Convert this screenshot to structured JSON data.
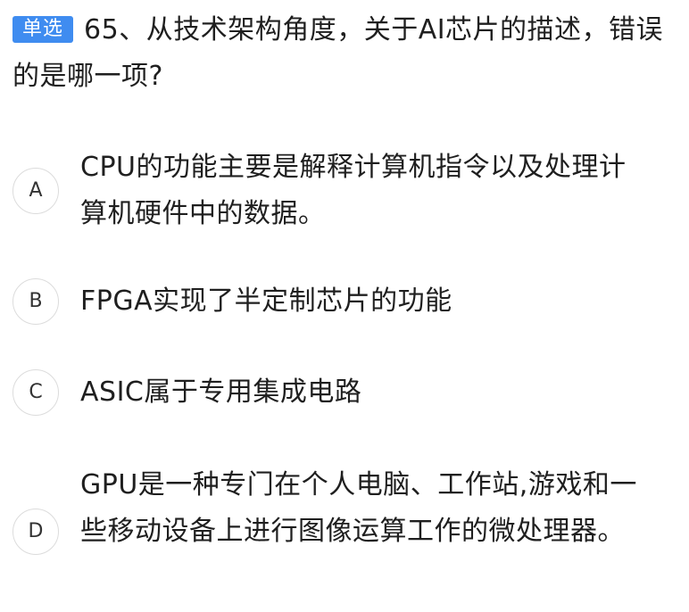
{
  "question": {
    "badge": "单选",
    "text": "65、从技术架构角度，关于AI芯片的描述，错误的是哪一项?"
  },
  "options": [
    {
      "letter": "A",
      "text": "CPU的功能主要是解释计算机指令以及处理计算机硬件中的数据。"
    },
    {
      "letter": "B",
      "text": "FPGA实现了半定制芯片的功能"
    },
    {
      "letter": "C",
      "text": "ASIC属于专用集成电路"
    },
    {
      "letter": "D",
      "text": "GPU是一种专门在个人电脑、工作站,游戏和一些移动设备上进行图像运算工作的微处理器。"
    }
  ],
  "colors": {
    "badge_bg": "#3f8cf0",
    "text": "#1f1f1f",
    "circle_border": "#dcdcdc"
  }
}
